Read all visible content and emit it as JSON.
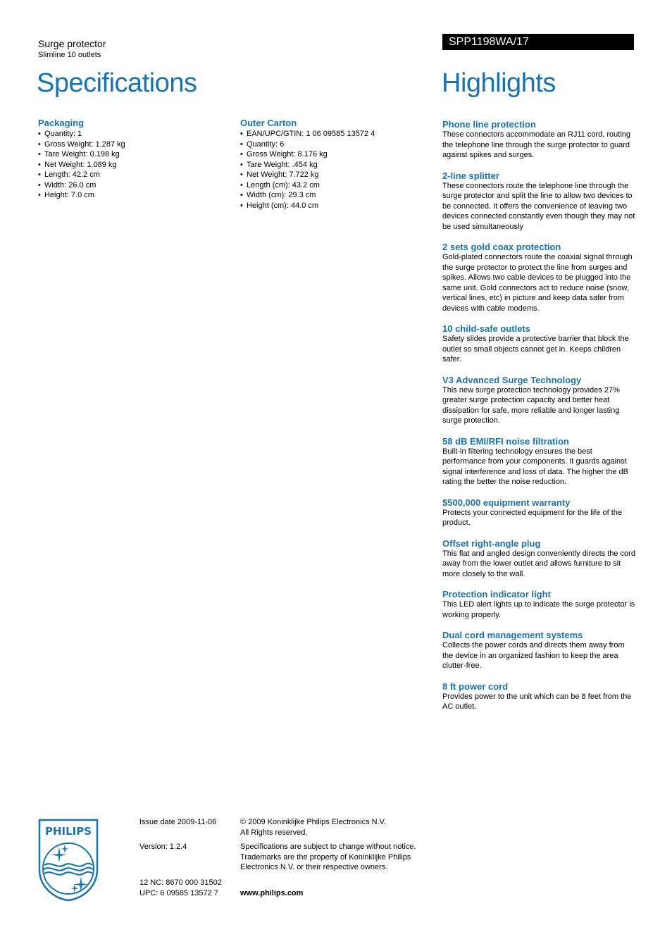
{
  "header": {
    "product_type": "Surge protector",
    "product_subtitle": "Slimline 10 outlets",
    "model": "SPP1198WA/17",
    "specifications_title": "Specifications",
    "highlights_title": "Highlights"
  },
  "specs": {
    "packaging": {
      "title": "Packaging",
      "items": [
        "Quantity: 1",
        "Gross Weight: 1.287 kg",
        "Tare Weight: 0.198 kg",
        "Net Weight: 1.089 kg",
        "Length: 42.2 cm",
        "Width: 26.0 cm",
        "Height: 7.0 cm"
      ]
    },
    "outer_carton": {
      "title": "Outer Carton",
      "items": [
        "EAN/UPC/GTIN: 1 06 09585 13572 4",
        "Quantity: 6",
        "Gross Weight: 8.176 kg",
        "Tare Weight: .454 kg",
        "Net Weight: 7.722 kg",
        "Length (cm): 43.2 cm",
        "Width (cm): 29.3 cm",
        "Height (cm): 44.0 cm"
      ]
    }
  },
  "highlights": [
    {
      "title": "Phone line protection",
      "text": "These connectors accommodate an RJ11 cord, routing the telephone line through the surge protector to guard against spikes and surges."
    },
    {
      "title": "2-line splitter",
      "text": "These connectors route the telephone line through the surge protector and split the line to allow two devices to be connected. It offers the convenience of leaving two devices connected constantly even though they may not be used simultaneously"
    },
    {
      "title": "2 sets gold coax protection",
      "text": "Gold-plated connectors route the coaxial signal through the surge protector to protect the line from surges and spikes. Allows two cable devices to be plugged into the same unit. Gold connectors act to reduce noise (snow, vertical lines, etc) in picture and keep data safer from devices with cable modems."
    },
    {
      "title": "10 child-safe outlets",
      "text": "Safety slides provide a protective barrier that block the outlet so small objects cannot get in. Keeps children safer."
    },
    {
      "title": "V3 Advanced Surge Technology",
      "text": "This new surge protection technology provides 27% greater surge protection capacity and better heat dissipation for safe, more reliable and longer lasting surge protection."
    },
    {
      "title": "58 dB EMI/RFI noise filtration",
      "text": "Built-in filtering technology ensures the best performance from your components. It guards against signal interference and loss of data. The higher the dB rating the better the noise reduction."
    },
    {
      "title": "$500,000 equipment warranty",
      "text": "Protects your connected equipment for the life of the product."
    },
    {
      "title": "Offset right-angle plug",
      "text": "This flat and angled design conveniently directs the cord away from the lower outlet and allows furniture to sit more closely to the wall."
    },
    {
      "title": "Protection indicator light",
      "text": "This LED alert lights up to indicate the surge protector is working properly."
    },
    {
      "title": "Dual cord management systems",
      "text": "Collects the power cords and directs them away from the device in an organized fashion to keep the area clutter-free."
    },
    {
      "title": "8 ft power cord",
      "text": "Provides power to the unit which can be 8 feet from the AC outlet."
    }
  ],
  "footer": {
    "logo_text": "PHILIPS",
    "issue_date": "Issue date 2009-11-06",
    "version": "Version: 1.2.4",
    "nc": "12 NC: 8670 000 31502",
    "upc": "UPC: 6 09585 13572 7",
    "copyright_line1": "© 2009 Koninklijke Philips Electronics N.V.",
    "copyright_line2": "All Rights reserved.",
    "disclaimer_line1": "Specifications are subject to change without notice.",
    "disclaimer_line2": "Trademarks are the property of Koninklijke Philips",
    "disclaimer_line3": "Electronics N.V. or their respective owners.",
    "website": "www.philips.com"
  },
  "colors": {
    "accent": "#1674b4",
    "model_bar": "#000000"
  }
}
